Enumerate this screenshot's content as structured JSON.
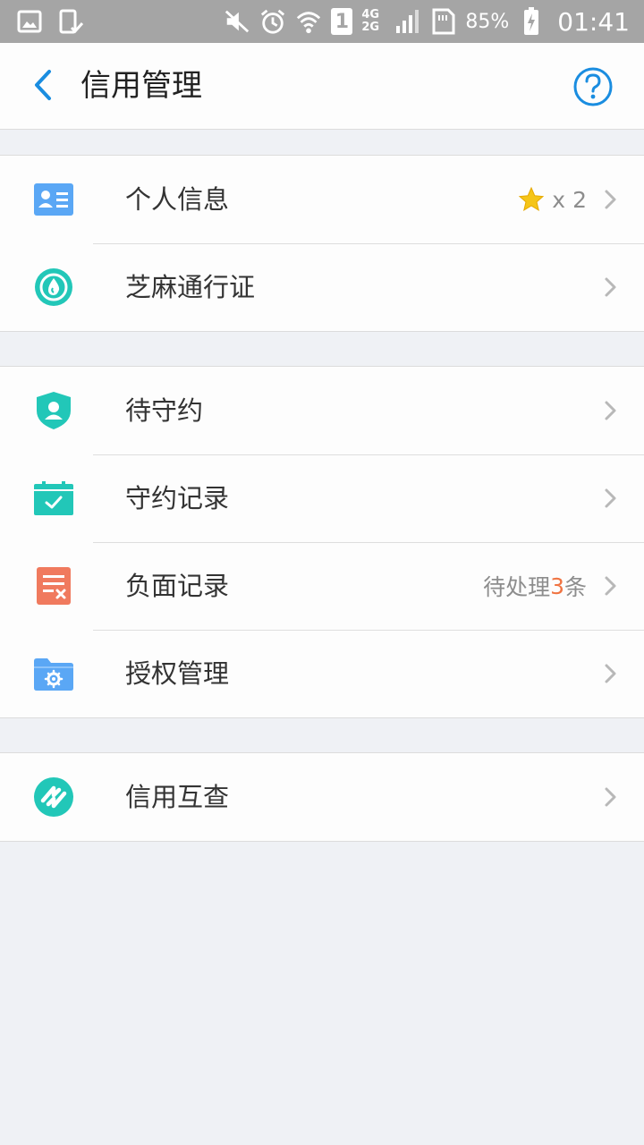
{
  "status_bar": {
    "net_top": "4G",
    "net_bottom": "2G",
    "sim": "1",
    "battery": "85%",
    "clock": "01:41"
  },
  "header": {
    "title": "信用管理"
  },
  "groups": [
    {
      "items": [
        {
          "label": "个人信息",
          "icon": "id-card-icon",
          "color": "#5aa7f5",
          "badge_prefix": "x",
          "badge_count": "2"
        },
        {
          "label": "芝麻通行证",
          "icon": "sesame-pass-icon",
          "color": "#22c7b8"
        }
      ]
    },
    {
      "items": [
        {
          "label": "待守约",
          "icon": "shield-user-icon",
          "color": "#22c7b8"
        },
        {
          "label": "守约记录",
          "icon": "calendar-check-icon",
          "color": "#22c7b8"
        },
        {
          "label": "负面记录",
          "icon": "document-x-icon",
          "color": "#f07a5e",
          "pending_text": "待处理",
          "pending_count": "3",
          "pending_unit": "条"
        },
        {
          "label": "授权管理",
          "icon": "folder-gear-icon",
          "color": "#5aa7f5"
        }
      ]
    },
    {
      "items": [
        {
          "label": "信用互查",
          "icon": "mutual-check-icon",
          "color": "#22c7b8"
        }
      ]
    }
  ],
  "colors": {
    "accent_blue": "#1a8de0",
    "teal": "#22c7b8",
    "alert_orange": "#f07442",
    "star_yellow": "#f5c518"
  }
}
